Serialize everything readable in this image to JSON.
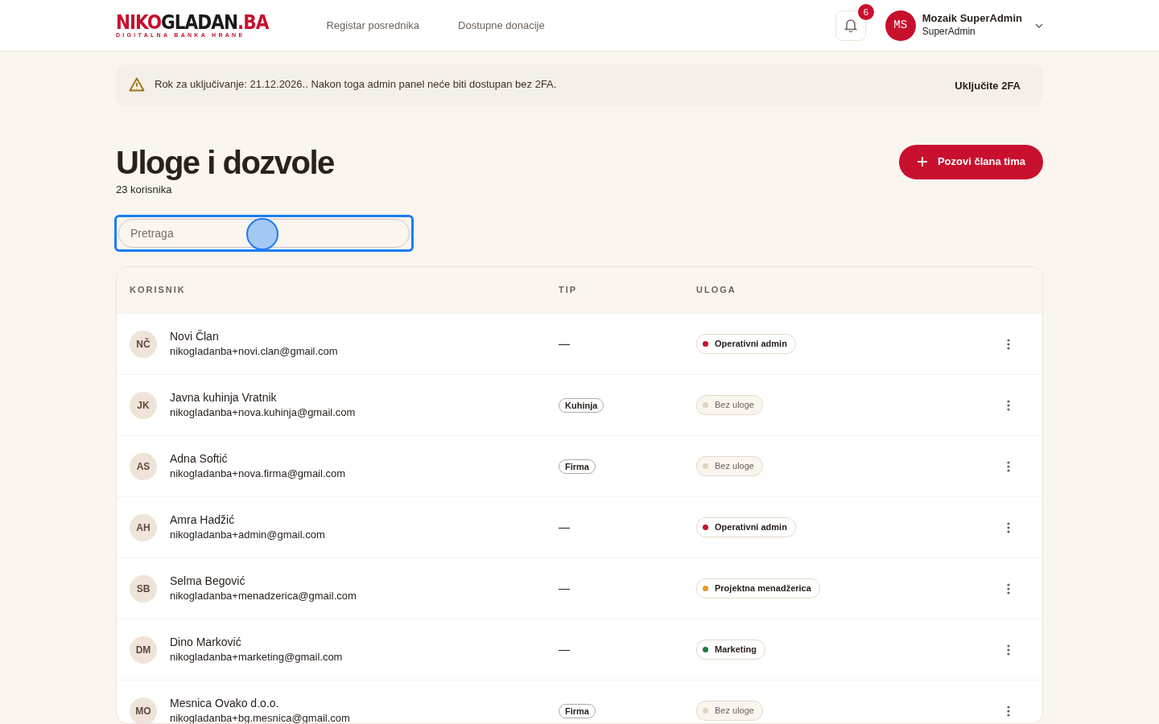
{
  "logo": {
    "parts": [
      {
        "text": "NIKO",
        "color": "#c8102e"
      },
      {
        "text": "GLADAN",
        "color": "#1a1a1a"
      },
      {
        "text": ".BA",
        "color": "#c8102e"
      }
    ],
    "tagline": "DIGITALNA BANKA HRANE"
  },
  "nav": [
    {
      "label": "Registar posrednika"
    },
    {
      "label": "Dostupne donacije"
    }
  ],
  "notifications": {
    "count": "6"
  },
  "user": {
    "initials": "MS",
    "name": "Mozaik SuperAdmin",
    "role": "SuperAdmin"
  },
  "alert": {
    "text": "Rok za uključivanje: 21.12.2026.. Nakon toga admin panel neće biti dostupan bez 2FA.",
    "action": "Uključite 2FA"
  },
  "page": {
    "title": "Uloge i dozvole",
    "subtitle": "23 korisnika",
    "invite_button": "Pozovi člana tima"
  },
  "search": {
    "placeholder": "Pretraga",
    "focused": true
  },
  "table": {
    "columns": [
      "KORISNIK",
      "TIP",
      "ULOGA"
    ],
    "rows": [
      {
        "initials": "NČ",
        "name": "Novi Član",
        "email": "nikogladanba+novi.clan@gmail.com",
        "type": {
          "kind": "dash",
          "text": "—"
        },
        "role": {
          "kind": "assigned",
          "text": "Operativni admin",
          "color": "#c8102e"
        }
      },
      {
        "initials": "JK",
        "name": "Javna kuhinja Vratnik",
        "email": "nikogladanba+nova.kuhinja@gmail.com",
        "type": {
          "kind": "tag",
          "text": "Kuhinja"
        },
        "role": {
          "kind": "none",
          "text": "Bez uloge",
          "color": "#e0d2c0"
        }
      },
      {
        "initials": "AS",
        "name": "Adna Softić",
        "email": "nikogladanba+nova.firma@gmail.com",
        "type": {
          "kind": "tag",
          "text": "Firma"
        },
        "role": {
          "kind": "none",
          "text": "Bez uloge",
          "color": "#e0d2c0"
        }
      },
      {
        "initials": "AH",
        "name": "Amra Hadžić",
        "email": "nikogladanba+admin@gmail.com",
        "type": {
          "kind": "dash",
          "text": "—"
        },
        "role": {
          "kind": "assigned",
          "text": "Operativni admin",
          "color": "#c8102e"
        }
      },
      {
        "initials": "SB",
        "name": "Selma Begović",
        "email": "nikogladanba+menadzerica@gmail.com",
        "type": {
          "kind": "dash",
          "text": "—"
        },
        "role": {
          "kind": "assigned",
          "text": "Projektna menadžerica",
          "color": "#e39a1f"
        }
      },
      {
        "initials": "DM",
        "name": "Dino Marković",
        "email": "nikogladanba+marketing@gmail.com",
        "type": {
          "kind": "dash",
          "text": "—"
        },
        "role": {
          "kind": "assigned",
          "text": "Marketing",
          "color": "#1e7a3c"
        }
      },
      {
        "initials": "MO",
        "name": "Mesnica Ovako d.o.o.",
        "email": "nikogladanba+bg.mesnica@gmail.com",
        "type": {
          "kind": "tag",
          "text": "Firma"
        },
        "role": {
          "kind": "none",
          "text": "Bez uloge",
          "color": "#e0d2c0"
        }
      }
    ]
  }
}
